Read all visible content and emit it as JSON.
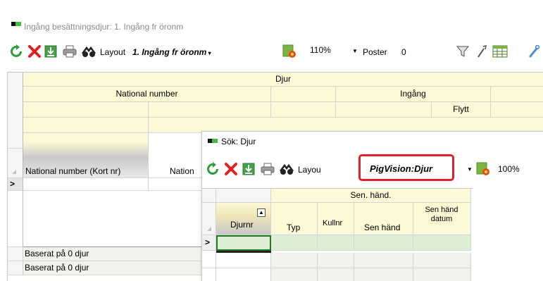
{
  "main": {
    "title": "Ingång besättningsdjur: 1. Ingång fr öronm",
    "toolbar": {
      "layout_label": "Layout",
      "layout_value": "1. Ingång fr öronm",
      "zoom": "110%",
      "records_label": "Poster",
      "records_value": "0"
    },
    "grid": {
      "group_header": "Djur",
      "national_number_group": "National number",
      "ingang_group": "Ingång",
      "flytt_header": "Flytt",
      "col_national_number_short": "National number (Kort nr)",
      "col_national_truncated": "Nation",
      "new_row_marker": ">",
      "summary_rows": [
        "Baserat på 0 djur",
        "Baserat på 0 djur"
      ]
    }
  },
  "popup": {
    "title": "Sök: Djur",
    "toolbar": {
      "layout_label": "Layou",
      "layout_value": "PigVision:Djur",
      "zoom": "100%"
    },
    "grid": {
      "group_header": "Sen. händ.",
      "columns": [
        "Djurnr",
        "Typ",
        "Kullnr",
        "Sen händ",
        "Sen händ datum"
      ],
      "new_row_marker": ">"
    }
  },
  "colors": {
    "accent_highlight": "#e0202a",
    "header_yellow": "#fcf9d6",
    "new_row_green": "#dcefd4"
  }
}
